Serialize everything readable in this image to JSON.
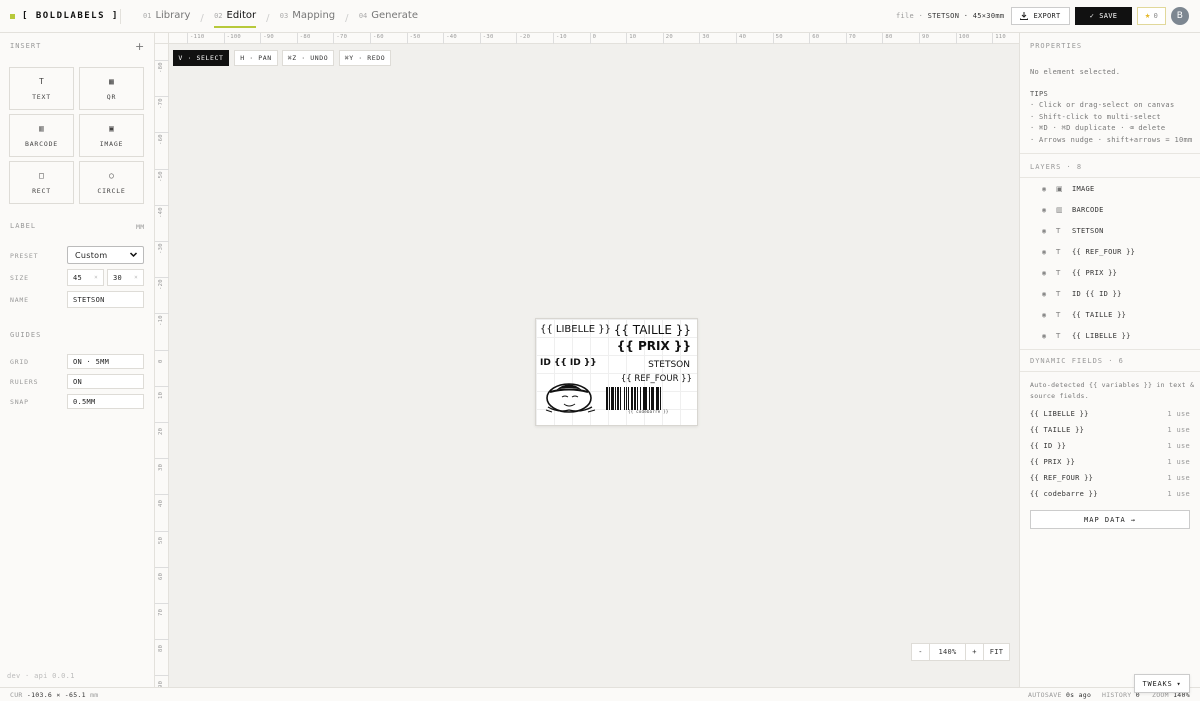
{
  "brand": {
    "name": "[ BOLDLABELS ]",
    "accent": "#b7c93b"
  },
  "tabs": [
    {
      "num": "01",
      "label": "Library"
    },
    {
      "num": "02",
      "label": "Editor"
    },
    {
      "num": "03",
      "label": "Mapping"
    },
    {
      "num": "04",
      "label": "Generate"
    }
  ],
  "header": {
    "file_prefix": "file ·",
    "file_name": "STETSON",
    "file_size": "· 45×30mm",
    "export_label": "EXPORT",
    "save_label": "SAVE",
    "star_count": "0",
    "avatar_initial": "B"
  },
  "insert": {
    "title": "INSERT",
    "tools": [
      {
        "icon": "T",
        "label": "TEXT"
      },
      {
        "icon": "▦",
        "label": "QR"
      },
      {
        "icon": "▥",
        "label": "BARCODE"
      },
      {
        "icon": "▣",
        "label": "IMAGE"
      },
      {
        "icon": "□",
        "label": "RECT"
      },
      {
        "icon": "○",
        "label": "CIRCLE"
      }
    ]
  },
  "label_settings": {
    "title": "LABEL",
    "unit": "MM",
    "preset_label": "PRESET",
    "preset_value": "Custom",
    "size_label": "SIZE",
    "width": "45",
    "height": "30",
    "name_label": "NAME",
    "name_value": "STETSON"
  },
  "guides": {
    "title": "GUIDES",
    "grid_label": "GRID",
    "grid_value": "ON · 5MM",
    "rulers_label": "RULERS",
    "rulers_value": "ON",
    "snap_label": "SNAP",
    "snap_value": "0.5MM"
  },
  "dev_version": "dev · api 0.0.1",
  "canvas": {
    "tools": [
      {
        "label": "V · SELECT"
      },
      {
        "label": "H · PAN"
      },
      {
        "label": "⌘Z · UNDO"
      },
      {
        "label": "⌘Y · REDO"
      }
    ],
    "h_ticks": [
      "-110",
      "-100",
      "-90",
      "-80",
      "-70",
      "-60",
      "-50",
      "-40",
      "-30",
      "-20",
      "-10",
      "0",
      "10",
      "20",
      "30",
      "40",
      "50",
      "60",
      "70",
      "80",
      "90",
      "100",
      "110"
    ],
    "v_ticks": [
      "-80",
      "-70",
      "-60",
      "-50",
      "-40",
      "-30",
      "-20",
      "-10",
      "0",
      "10",
      "20",
      "30",
      "40",
      "50",
      "60",
      "70",
      "80",
      "90"
    ],
    "zoom_minus": "-",
    "zoom_value": "140%",
    "zoom_plus": "+",
    "zoom_fit": "FIT"
  },
  "label_content": {
    "libelle": "{{ LIBELLE }}",
    "taille": "{{ TAILLE }}",
    "prix": "{{ PRIX }}",
    "id": "ID {{ ID }}",
    "brand": "STETSON",
    "ref_four": "{{ REF_FOUR }}",
    "barcode_caption": "{{ codebarre }}"
  },
  "properties": {
    "title": "PROPERTIES",
    "empty": "No element selected.",
    "tips_title": "TIPS",
    "tips": [
      "· Click or drag-select on canvas",
      "· Shift-click to multi-select",
      "· ⌘D · ⌘D duplicate · ⌫ delete",
      "· Arrows nudge · shift+arrows = 10mm"
    ]
  },
  "layers": {
    "title": "LAYERS · 8",
    "items": [
      {
        "type": "image",
        "name": "IMAGE"
      },
      {
        "type": "barcode",
        "name": "BARCODE"
      },
      {
        "type": "text",
        "name": "STETSON"
      },
      {
        "type": "text",
        "name": "{{ REF_FOUR }}"
      },
      {
        "type": "text",
        "name": "{{ PRIX }}"
      },
      {
        "type": "text",
        "name": "ID {{ ID }}"
      },
      {
        "type": "text",
        "name": "{{ TAILLE }}"
      },
      {
        "type": "text",
        "name": "{{ LIBELLE }}"
      }
    ]
  },
  "dynamic_fields": {
    "title": "DYNAMIC FIELDS · 6",
    "description_1": "Auto-detected {{ variables }} in text &",
    "description_2": "source fields.",
    "items": [
      {
        "name": "{{ LIBELLE }}",
        "use": "1 use"
      },
      {
        "name": "{{ TAILLE }}",
        "use": "1 use"
      },
      {
        "name": "{{ ID }}",
        "use": "1 use"
      },
      {
        "name": "{{ PRIX }}",
        "use": "1 use"
      },
      {
        "name": "{{ REF_FOUR }}",
        "use": "1 use"
      },
      {
        "name": "{{ codebarre }}",
        "use": "1 use"
      }
    ],
    "map_button": "MAP DATA"
  },
  "status": {
    "cur_label": "CUR",
    "cur_value": "-103.6 × -65.1",
    "cur_unit": "mm",
    "autosave_label": "AUTOSAVE",
    "autosave_value": "0s ago",
    "history_label": "HISTORY",
    "history_value": "0",
    "zoom_label": "ZOOM",
    "zoom_value": "140%",
    "tweaks_label": "TWEAKS"
  }
}
